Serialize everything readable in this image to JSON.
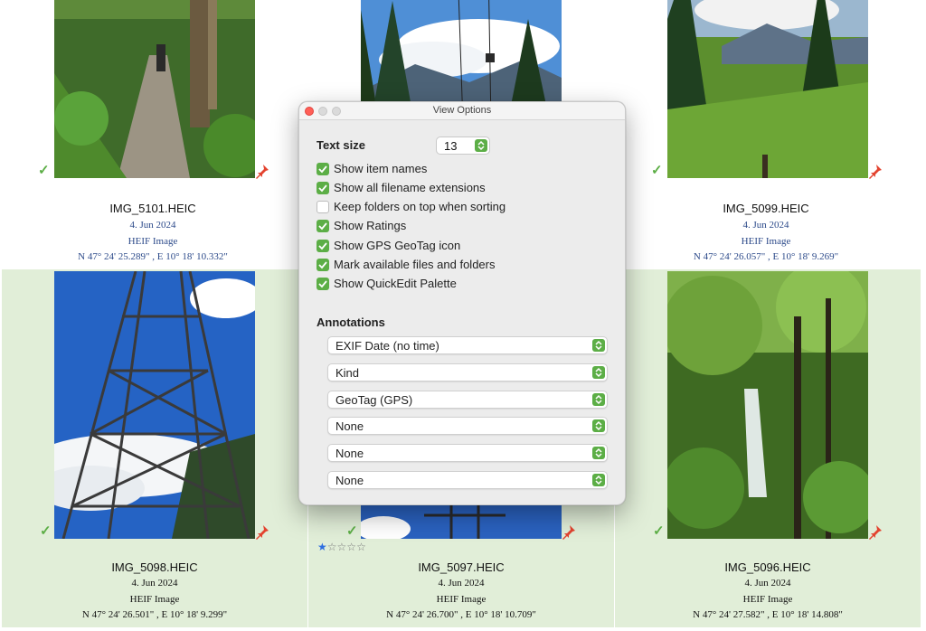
{
  "colors": {
    "accent": "#5cae46",
    "marked_bg": "#e1eed8",
    "pin": "#e3432f",
    "star": "#2f6fe0"
  },
  "icons": {
    "check": "checkmark-icon",
    "pin": "pushpin-icon",
    "star": "star-icon"
  },
  "grid": {
    "cells": [
      {
        "name": "",
        "date": "",
        "kind": "",
        "geo": ""
      },
      {
        "name": "",
        "date": "",
        "kind": "",
        "geo": ""
      },
      {
        "name": "IMG_5101.HEIC",
        "date": "4. Jun 2024",
        "kind": "HEIF Image",
        "geo": "N 47° 24' 25.289\" , E 10° 18' 10.332\""
      },
      {
        "name": "IMG_5099.HEIC",
        "date": "4. Jun 2024",
        "kind": "HEIF Image",
        "geo": "N 47° 24' 26.057\" , E 10° 18' 9.269\""
      },
      {
        "name": "IMG_5098.HEIC",
        "date": "4. Jun 2024",
        "kind": "HEIF Image",
        "geo": "N 47° 24' 26.501\" , E 10° 18' 9.299\""
      },
      {
        "name": "IMG_5097.HEIC",
        "date": "4. Jun 2024",
        "kind": "HEIF Image",
        "geo": "N 47° 24' 26.700\" , E 10° 18' 10.709\"",
        "rating": 1
      },
      {
        "name": "IMG_5096.HEIC",
        "date": "4. Jun 2024",
        "kind": "HEIF Image",
        "geo": "N 47° 24' 27.582\" , E 10° 18' 14.808\""
      }
    ]
  },
  "panel": {
    "title": "View Options",
    "text_size_label": "Text size",
    "text_size_value": "13",
    "options": [
      {
        "label": "Show item names",
        "checked": true
      },
      {
        "label": "Show all filename extensions",
        "checked": true
      },
      {
        "label": "Keep folders on top when sorting",
        "checked": false
      },
      {
        "label": "Show Ratings",
        "checked": true
      },
      {
        "label": "Show GPS GeoTag icon",
        "checked": true
      },
      {
        "label": "Mark available files and folders",
        "checked": true
      },
      {
        "label": "Show QuickEdit Palette",
        "checked": true
      }
    ],
    "annotations_label": "Annotations",
    "annotations": [
      "EXIF Date (no time)",
      "Kind",
      "GeoTag (GPS)",
      "None",
      "None",
      "None"
    ]
  }
}
